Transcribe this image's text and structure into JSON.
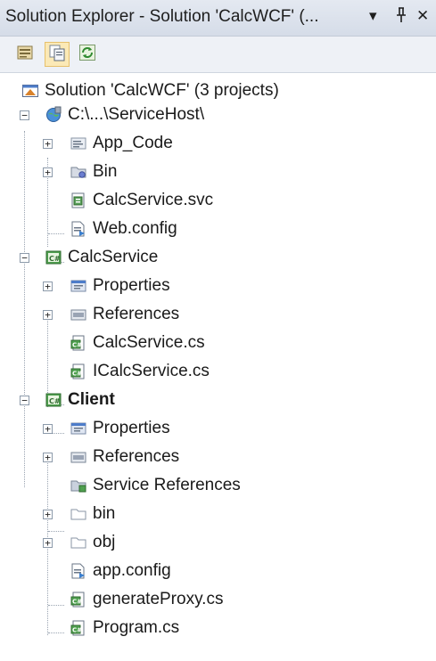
{
  "window": {
    "title": "Solution Explorer - Solution 'CalcWCF' (...",
    "dropdown_glyph": "▾",
    "pin_glyph": "ꟸ",
    "close_glyph": "✕"
  },
  "toolbar": {
    "buttons": [
      {
        "icon": "properties-icon"
      },
      {
        "icon": "show-all-files-icon",
        "active": true
      },
      {
        "icon": "refresh-icon"
      }
    ]
  },
  "tree": {
    "solution": "Solution 'CalcWCF' (3 projects)",
    "service_host": {
      "label": "C:\\...\\ServiceHost\\",
      "items": [
        "App_Code",
        "Bin",
        "CalcService.svc",
        "Web.config"
      ]
    },
    "calc_service": {
      "label": "CalcService",
      "items": [
        "Properties",
        "References",
        "CalcService.cs",
        "ICalcService.cs"
      ]
    },
    "client": {
      "label": "Client",
      "items": [
        "Properties",
        "References",
        "Service References",
        "bin",
        "obj",
        "app.config",
        "generateProxy.cs",
        "Program.cs"
      ]
    },
    "expand_symbol": "+",
    "collapse_symbol": "−"
  }
}
